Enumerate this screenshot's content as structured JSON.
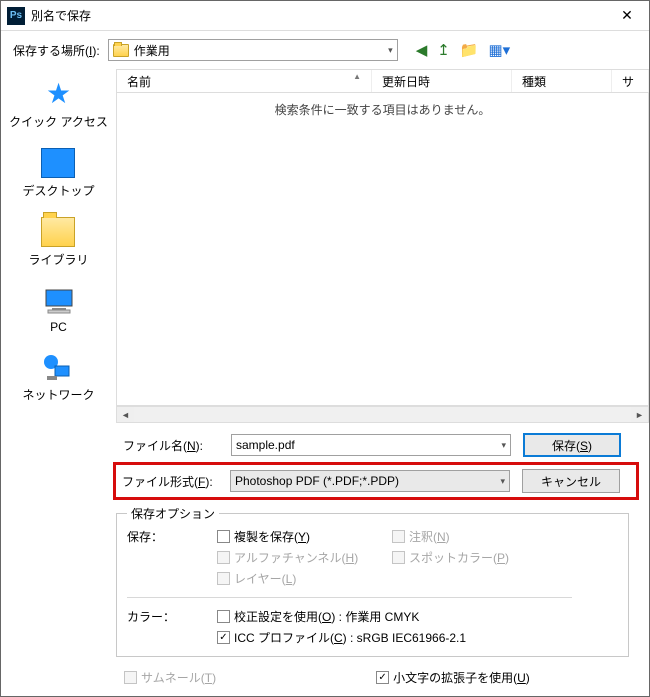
{
  "title": "別名で保存",
  "location_label_pre": "保存する場所(",
  "location_label_u": "I",
  "location_label_post": "):",
  "location": {
    "value": "作業用"
  },
  "columns": {
    "name": "名前",
    "date": "更新日時",
    "kind": "種類",
    "size": "サ"
  },
  "file_area": {
    "empty": "検索条件に一致する項目はありません。"
  },
  "places": {
    "quick": "クイック アクセス",
    "desktop": "デスクトップ",
    "library": "ライブラリ",
    "pc": "PC",
    "network": "ネットワーク"
  },
  "labels": {
    "filename_pre": "ファイル名(",
    "filename_u": "N",
    "filename_post": "):",
    "format_pre": "ファイル形式(",
    "format_u": "F",
    "format_post": "):"
  },
  "filename": {
    "value": "sample.pdf"
  },
  "format": {
    "value": "Photoshop PDF (*.PDF;*.PDP)"
  },
  "buttons": {
    "save_pre": "保存(",
    "save_u": "S",
    "save_post": ")",
    "cancel": "キャンセル"
  },
  "opts": {
    "legend": "保存オプション",
    "save_label": "保存：",
    "copy_pre": "複製を保存(",
    "copy_u": "Y",
    "copy_post": ")",
    "notes_pre": "注釈(",
    "notes_u": "N",
    "notes_post": ")",
    "alpha_pre": "アルファチャンネル(",
    "alpha_u": "H",
    "alpha_post": ")",
    "spot_pre": "スポットカラー(",
    "spot_u": "P",
    "spot_post": ")",
    "layer_pre": "レイヤー(",
    "layer_u": "L",
    "layer_post": ")",
    "color_label": "カラー：",
    "proof_pre": "校正設定を使用(",
    "proof_u": "O",
    "proof_post": ") : 作業用 CMYK",
    "icc_pre": "ICC プロファイル(",
    "icc_u": "C",
    "icc_post": ") : sRGB IEC61966-2.1"
  },
  "footer": {
    "thumb_pre": "サムネール(",
    "thumb_u": "T",
    "thumb_post": ")",
    "lower_pre": "小文字の拡張子を使用(",
    "lower_u": "U",
    "lower_post": ")"
  }
}
